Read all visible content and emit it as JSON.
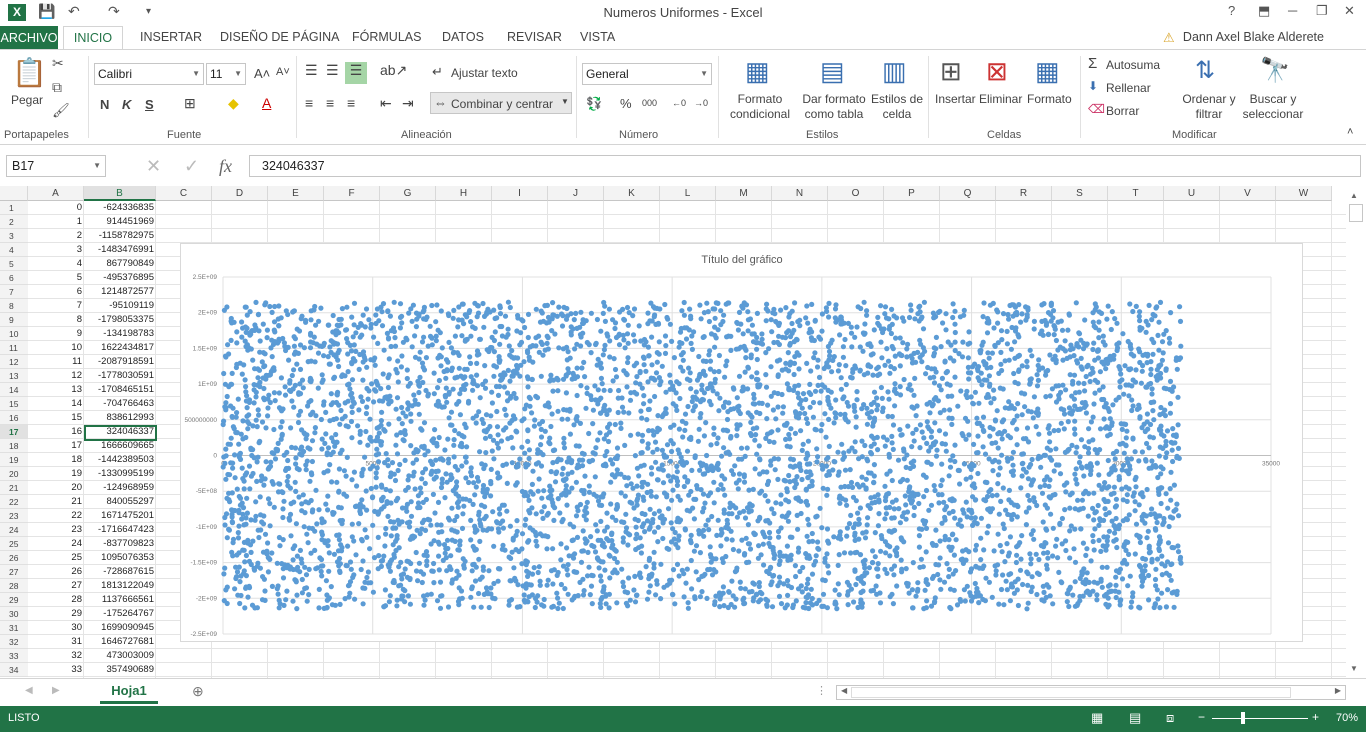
{
  "window": {
    "title": "Numeros Uniformes - Excel",
    "help": "?",
    "minimize": "─",
    "restore": "❐",
    "close": "✕"
  },
  "tabs": {
    "file": "ARCHIVO",
    "home": "INICIO",
    "insert": "INSERTAR",
    "layout": "DISEÑO DE PÁGINA",
    "formulas": "FÓRMULAS",
    "data": "DATOS",
    "review": "REVISAR",
    "view": "VISTA"
  },
  "user": {
    "name": "Dann Axel Blake Alderete"
  },
  "ribbon": {
    "clipboard": {
      "label": "Portapapeles",
      "paste": "Pegar"
    },
    "font": {
      "label": "Fuente",
      "name": "Calibri",
      "size": "11",
      "bold": "N",
      "italic": "K",
      "underline": "S"
    },
    "alignment": {
      "label": "Alineación",
      "wrap": "Ajustar texto",
      "merge": "Combinar y centrar"
    },
    "number": {
      "label": "Número",
      "format": "General"
    },
    "styles": {
      "label": "Estilos",
      "conditional": "Formato condicional",
      "as_table": "Dar formato como tabla",
      "cell_styles": "Estilos de celda"
    },
    "cells": {
      "label": "Celdas",
      "insert": "Insertar",
      "delete": "Eliminar",
      "format": "Formato"
    },
    "editing": {
      "label": "Modificar",
      "autosum": "Autosuma",
      "fill": "Rellenar",
      "clear": "Borrar",
      "sort": "Ordenar y filtrar",
      "find": "Buscar y seleccionar"
    }
  },
  "formula_bar": {
    "name_box": "B17",
    "value": "324046337",
    "fx": "fx"
  },
  "columns": [
    "A",
    "B",
    "C",
    "D",
    "E",
    "F",
    "G",
    "H",
    "I",
    "J",
    "K",
    "L",
    "M",
    "N",
    "O",
    "P",
    "Q",
    "R",
    "S",
    "T",
    "U",
    "V",
    "W"
  ],
  "rows": [
    {
      "n": "1",
      "a": "0",
      "b": "-624336835"
    },
    {
      "n": "2",
      "a": "1",
      "b": "914451969"
    },
    {
      "n": "3",
      "a": "2",
      "b": "-1158782975"
    },
    {
      "n": "4",
      "a": "3",
      "b": "-1483476991"
    },
    {
      "n": "5",
      "a": "4",
      "b": "867790849"
    },
    {
      "n": "6",
      "a": "5",
      "b": "-495376895"
    },
    {
      "n": "7",
      "a": "6",
      "b": "1214872577"
    },
    {
      "n": "8",
      "a": "7",
      "b": "-95109119"
    },
    {
      "n": "9",
      "a": "8",
      "b": "-1798053375"
    },
    {
      "n": "10",
      "a": "9",
      "b": "-134198783"
    },
    {
      "n": "11",
      "a": "10",
      "b": "1622434817"
    },
    {
      "n": "12",
      "a": "11",
      "b": "-2087918591"
    },
    {
      "n": "13",
      "a": "12",
      "b": "-1778030591"
    },
    {
      "n": "14",
      "a": "13",
      "b": "-1708465151"
    },
    {
      "n": "15",
      "a": "14",
      "b": "-704766463"
    },
    {
      "n": "16",
      "a": "15",
      "b": "838612993"
    },
    {
      "n": "17",
      "a": "16",
      "b": "324046337"
    },
    {
      "n": "18",
      "a": "17",
      "b": "1666609665"
    },
    {
      "n": "19",
      "a": "18",
      "b": "-1442389503"
    },
    {
      "n": "20",
      "a": "19",
      "b": "-1330995199"
    },
    {
      "n": "21",
      "a": "20",
      "b": "-124968959"
    },
    {
      "n": "22",
      "a": "21",
      "b": "840055297"
    },
    {
      "n": "23",
      "a": "22",
      "b": "1671475201"
    },
    {
      "n": "24",
      "a": "23",
      "b": "-1716647423"
    },
    {
      "n": "25",
      "a": "24",
      "b": "-837709823"
    },
    {
      "n": "26",
      "a": "25",
      "b": "1095076353"
    },
    {
      "n": "27",
      "a": "26",
      "b": "-728687615"
    },
    {
      "n": "28",
      "a": "27",
      "b": "1813122049"
    },
    {
      "n": "29",
      "a": "28",
      "b": "1137666561"
    },
    {
      "n": "30",
      "a": "29",
      "b": "-175264767"
    },
    {
      "n": "31",
      "a": "30",
      "b": "1699090945"
    },
    {
      "n": "32",
      "a": "31",
      "b": "1646727681"
    },
    {
      "n": "33",
      "a": "32",
      "b": "473003009"
    },
    {
      "n": "34",
      "a": "33",
      "b": "357490689"
    }
  ],
  "chart_data": {
    "type": "scatter",
    "title": "Título del gráfico",
    "xlabel": "",
    "ylabel": "",
    "xlim": [
      0,
      35000
    ],
    "ylim": [
      -2500000000,
      2500000000
    ],
    "x_ticks": [
      "0",
      "5000",
      "10000",
      "15000",
      "20000",
      "25000",
      "30000",
      "35000"
    ],
    "y_ticks": [
      "2.5E+09",
      "2E+09",
      "1.5E+09",
      "1E+09",
      "500000000",
      "0",
      "-5E+08",
      "-1E+09",
      "-1.5E+09",
      "-2E+09",
      "-2.5E+09"
    ],
    "point_count": 32000,
    "x_range": [
      0,
      32000
    ],
    "y_range": [
      -2147483648,
      2147483647
    ],
    "distribution": "uniform",
    "color": "#5b9bd5",
    "grid": true
  },
  "sheets": [
    {
      "name": "Hoja1"
    }
  ],
  "status": {
    "mode": "LISTO",
    "zoom": "70%"
  }
}
